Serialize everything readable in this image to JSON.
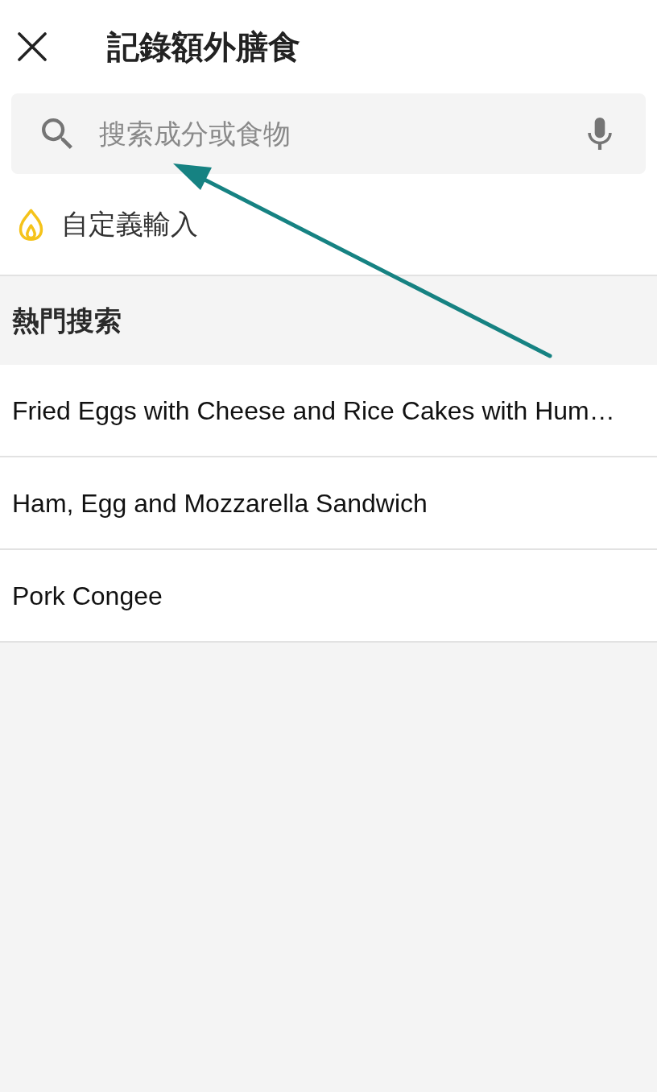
{
  "header": {
    "title": "記錄額外膳食"
  },
  "search": {
    "placeholder": "搜索成分或食物"
  },
  "custom_entry": {
    "label": "自定義輸入"
  },
  "popular": {
    "heading": "熱門搜索",
    "items": [
      "Fried Eggs with Cheese and Rice Cakes with Hum…",
      "Ham, Egg and Mozzarella Sandwich",
      "Pork Congee"
    ]
  }
}
